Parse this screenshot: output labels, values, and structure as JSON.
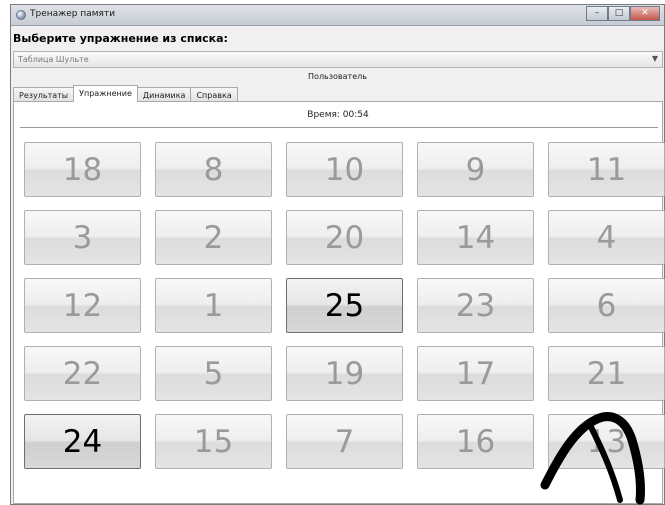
{
  "window": {
    "title": "Тренажер памяти"
  },
  "header": {
    "label": "Выберите упражнение из списка:"
  },
  "combo": {
    "value": "Таблица Шульте"
  },
  "user": {
    "label": "Пользователь"
  },
  "tabs": [
    {
      "label": "Результаты"
    },
    {
      "label": "Упражнение"
    },
    {
      "label": "Динамика"
    },
    {
      "label": "Справка"
    }
  ],
  "timer": {
    "text": "Время: 00:54"
  },
  "grid": {
    "numbers": [
      [
        "18",
        "8",
        "10",
        "9",
        "11"
      ],
      [
        "3",
        "2",
        "20",
        "14",
        "4"
      ],
      [
        "12",
        "1",
        "25",
        "23",
        "6"
      ],
      [
        "22",
        "5",
        "19",
        "17",
        "21"
      ],
      [
        "24",
        "15",
        "7",
        "16",
        "13"
      ]
    ]
  },
  "colors": {
    "stroke_overlay": "#000000",
    "tile_text": "#9a9a9a",
    "tile_text_active": "#000000"
  }
}
